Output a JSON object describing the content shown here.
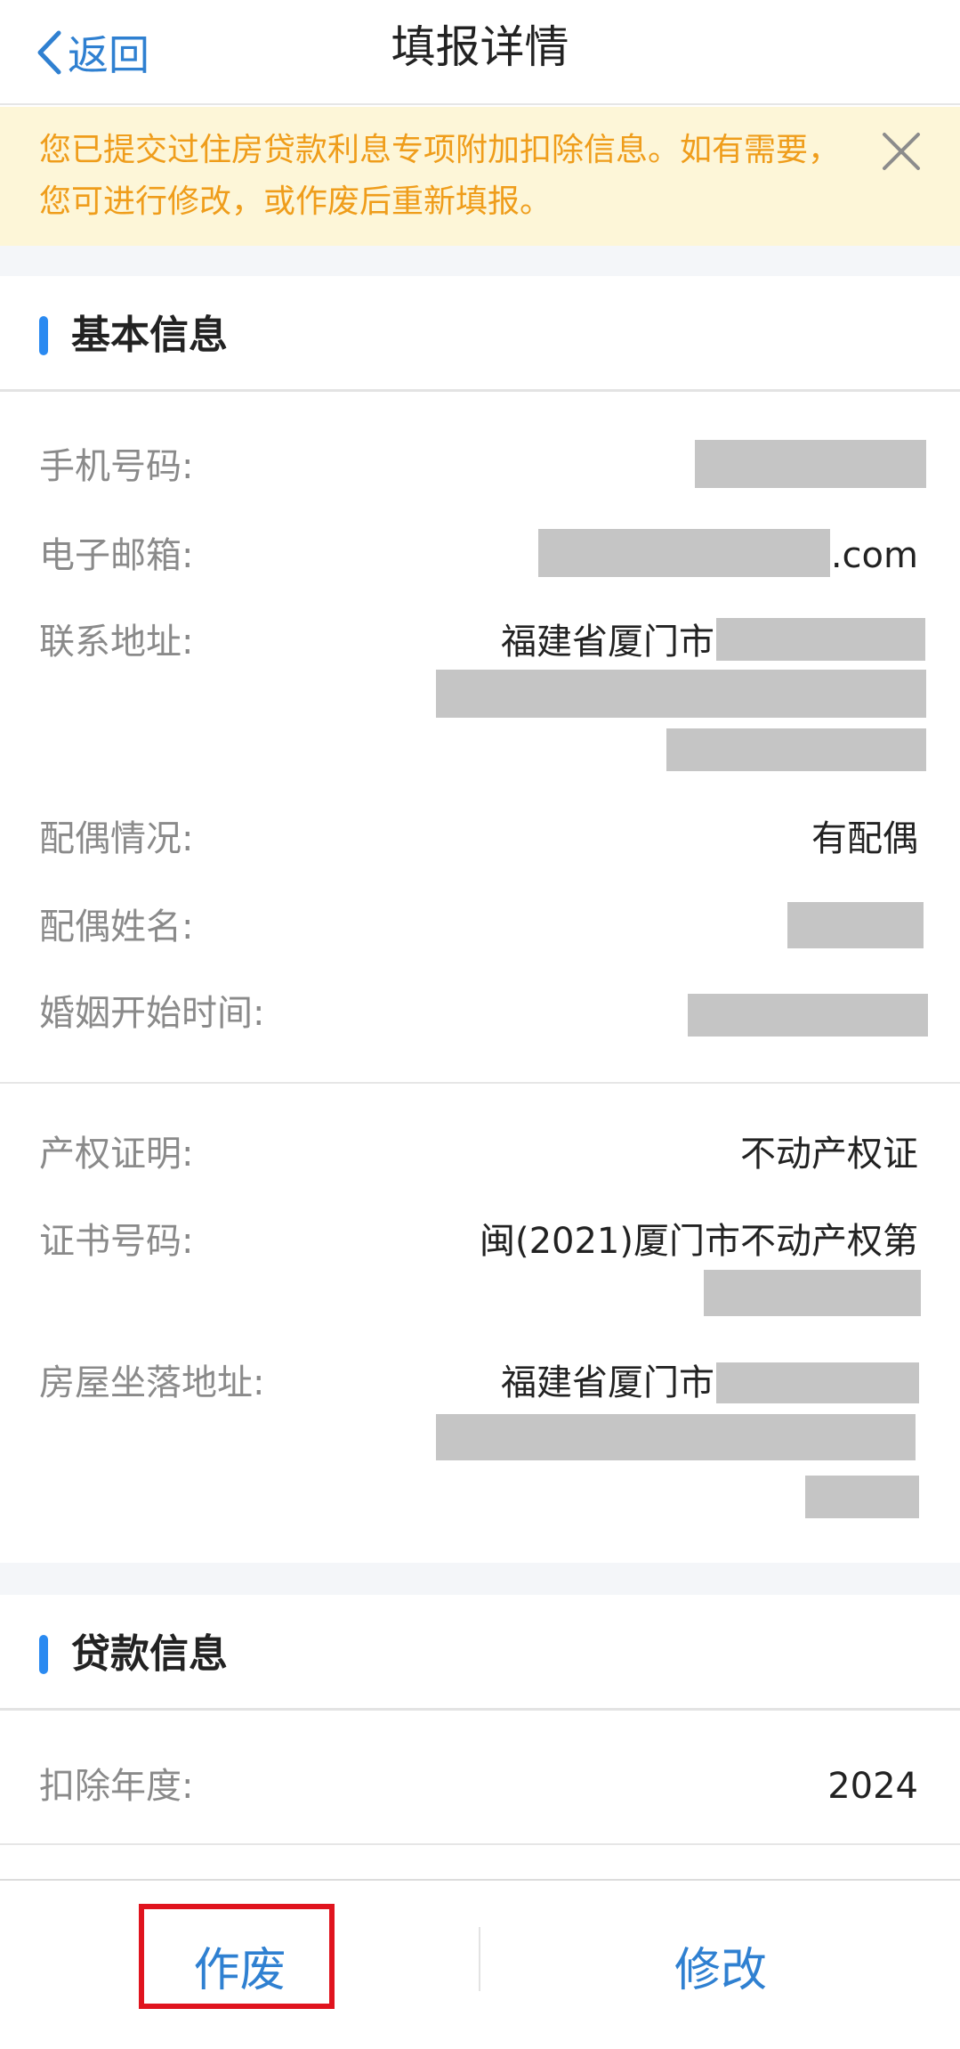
{
  "nav": {
    "back_label": "返回",
    "title": "填报详情"
  },
  "notice": {
    "text": "您已提交过住房贷款利息专项附加扣除信息。如有需要，您可进行修改，或作废后重新填报。"
  },
  "basic_info": {
    "title": "基本信息",
    "phone_label": "手机号码:",
    "email_label": "电子邮箱:",
    "email_suffix": ".com",
    "address_label": "联系地址:",
    "address_prefix": "福建省厦门市",
    "spouse_status_label": "配偶情况:",
    "spouse_status_value": "有配偶",
    "spouse_name_label": "配偶姓名:",
    "marriage_date_label": "婚姻开始时间:",
    "property_proof_label": "产权证明:",
    "property_proof_value": "不动产权证",
    "cert_no_label": "证书号码:",
    "cert_no_value": "闽(2021)厦门市不动产权第",
    "house_address_label": "房屋坐落地址:",
    "house_address_prefix": "福建省厦门市"
  },
  "loan_info": {
    "title": "贷款信息",
    "deduction_year_label": "扣除年度:",
    "deduction_year_value": "2024"
  },
  "actions": {
    "void_label": "作废",
    "edit_label": "修改"
  },
  "colors": {
    "accent": "#2f80d1",
    "notice_text": "#ef9d1b",
    "notice_bg": "#fdf6d8",
    "highlight_border": "#e0141e"
  }
}
